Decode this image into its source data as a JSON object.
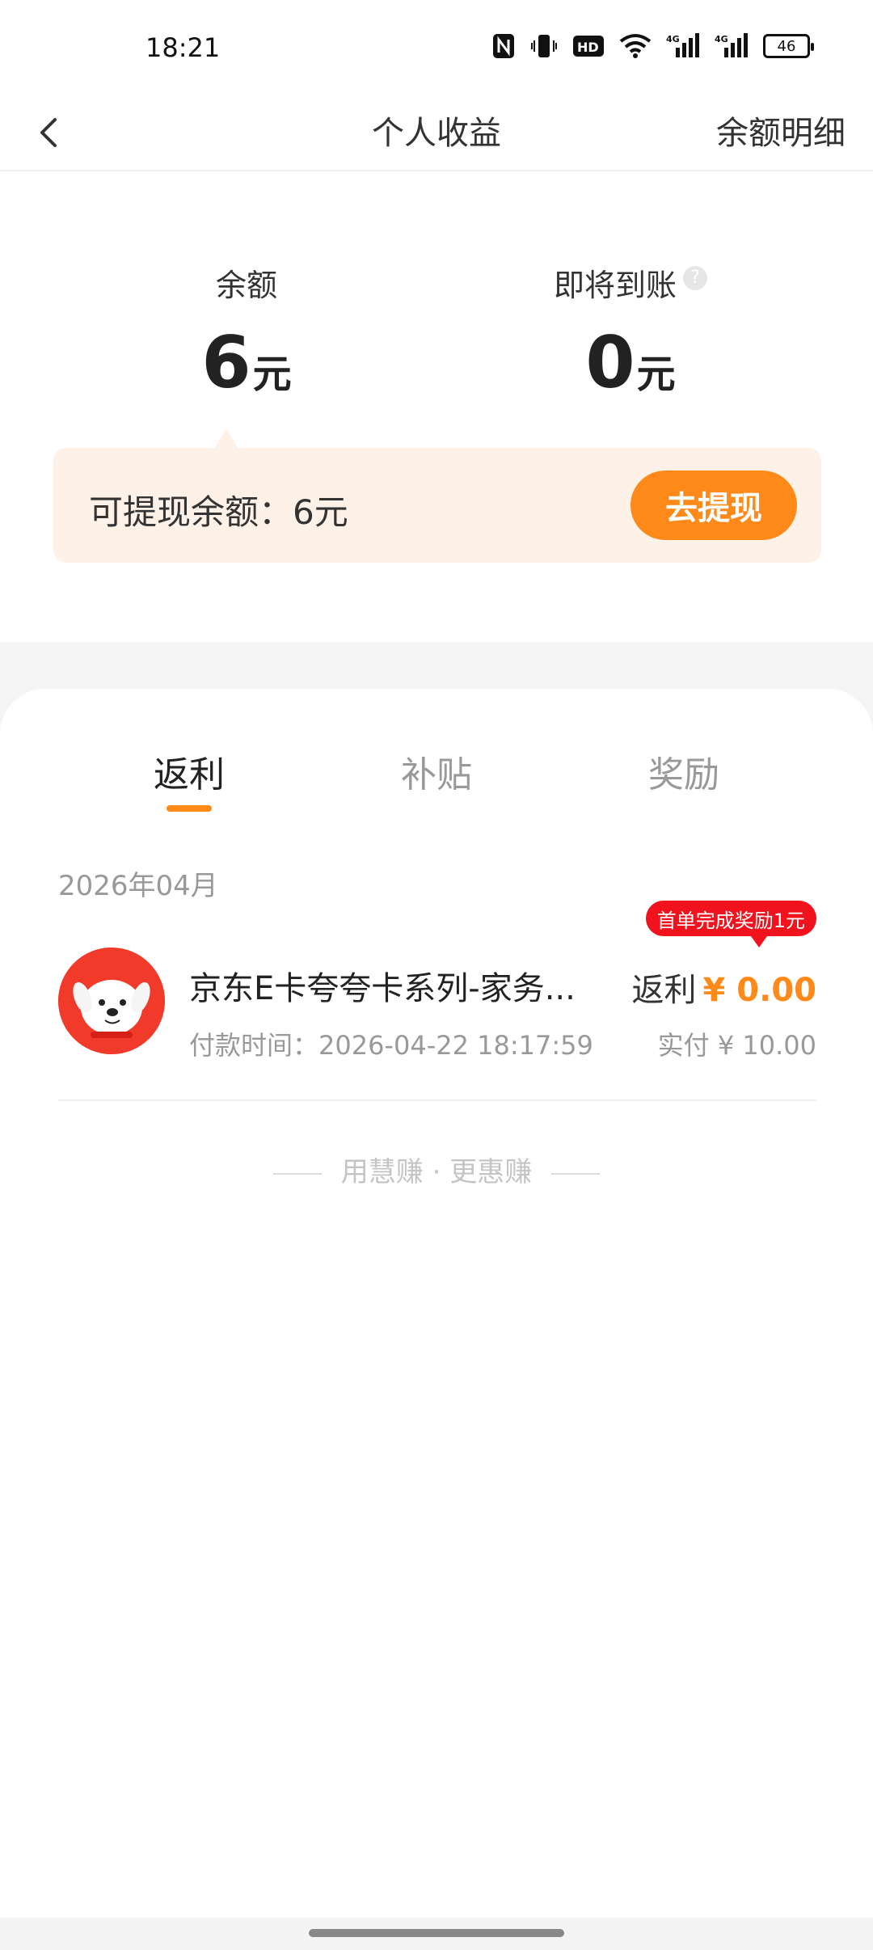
{
  "status_bar": {
    "time": "18:21",
    "battery": "46",
    "icons": [
      "nfc-icon",
      "vibrate-icon",
      "hd-icon",
      "wifi-icon",
      "signal-4g-icon",
      "signal-4g-icon"
    ]
  },
  "header": {
    "title": "个人收益",
    "right_link": "余额明细"
  },
  "summary": {
    "balance_label": "余额",
    "balance_value": "6",
    "balance_unit": "元",
    "pending_label": "即将到账",
    "pending_value": "0",
    "pending_unit": "元",
    "withdrawable_text": "可提现余额：6元",
    "withdraw_button": "去提现"
  },
  "tabs": [
    {
      "label": "返利",
      "active": true
    },
    {
      "label": "补贴",
      "active": false
    },
    {
      "label": "奖励",
      "active": false
    }
  ],
  "records": {
    "month": "2026年04月",
    "items": [
      {
        "name": "京东E卡夸夸卡系列-家务...",
        "time": "付款时间：2026-04-22 18:17:59",
        "badge": "首单完成奖励1元",
        "rebate_label": "返利",
        "rebate_amount": "¥ 0.00",
        "paid": "实付 ¥ 10.00"
      }
    ]
  },
  "footer": {
    "slogan": "用慧赚 · 更惠赚"
  },
  "colors": {
    "accent": "#ff8a1a",
    "badge": "#f0131d",
    "withdraw_bg": "#fdf1e8"
  }
}
